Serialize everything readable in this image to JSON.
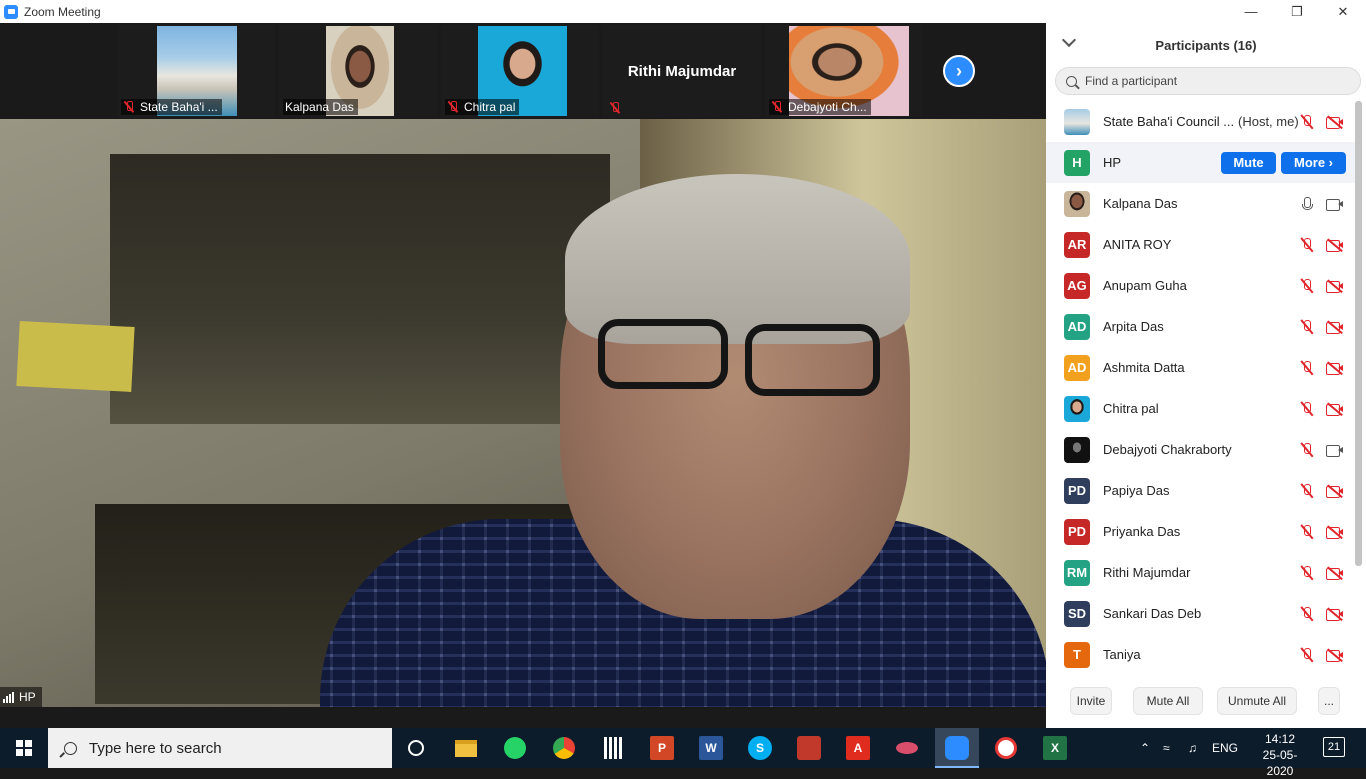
{
  "window": {
    "title": "Zoom Meeting",
    "controls": [
      "minimize",
      "restore",
      "close"
    ]
  },
  "gallery": {
    "tiles": [
      {
        "name": "State Baha'i ...",
        "muted": true,
        "has_video": true,
        "photo": "lotus-temple"
      },
      {
        "name": "Kalpana Das",
        "muted": false,
        "has_video": true,
        "photo": "woman"
      },
      {
        "name": "Chitra pal",
        "muted": true,
        "has_video": true,
        "photo": "woman"
      },
      {
        "name": "Rithi Majumdar",
        "muted": true,
        "has_video": false
      },
      {
        "name": "Debajyoti Ch...",
        "muted": true,
        "has_video": true,
        "photo": "young-man"
      }
    ],
    "next_icon": "chevron-right-icon"
  },
  "main_video": {
    "speaker_label": "HP",
    "icon": "signal-bars-icon"
  },
  "participants": {
    "title": "Participants (16)",
    "search_placeholder": "Find a participant",
    "list": [
      {
        "initials": "",
        "name": "State Baha'i Council ...",
        "tag": "(Host, me)",
        "avatar_color": "#3a6e8f",
        "mic": "muted",
        "cam": "off"
      },
      {
        "initials": "H",
        "name": "HP",
        "avatar_color": "#23a365",
        "mute_label": "Mute",
        "more_label": "More"
      },
      {
        "initials": "",
        "name": "Kalpana Das",
        "avatar_color": "#8a5a44",
        "mic": "on",
        "cam": "on"
      },
      {
        "initials": "AR",
        "name": "ANITA ROY",
        "avatar_color": "#c62828",
        "mic": "muted",
        "cam": "off"
      },
      {
        "initials": "AG",
        "name": "Anupam Guha",
        "avatar_color": "#c62828",
        "mic": "muted",
        "cam": "off"
      },
      {
        "initials": "AD",
        "name": "Arpita Das",
        "avatar_color": "#23a383",
        "mic": "muted",
        "cam": "off"
      },
      {
        "initials": "AD",
        "name": "Ashmita Datta",
        "avatar_color": "#f2a11e",
        "mic": "muted",
        "cam": "off"
      },
      {
        "initials": "",
        "name": "Chitra pal",
        "avatar_color": "#3aa6d8",
        "mic": "muted",
        "cam": "off"
      },
      {
        "initials": "",
        "name": "Debajyoti Chakraborty",
        "avatar_color": "#222222",
        "mic": "muted",
        "cam": "on"
      },
      {
        "initials": "PD",
        "name": "Papiya Das",
        "avatar_color": "#2f3e5c",
        "mic": "muted",
        "cam": "off"
      },
      {
        "initials": "PD",
        "name": "Priyanka Das",
        "avatar_color": "#c62828",
        "mic": "muted",
        "cam": "off"
      },
      {
        "initials": "RM",
        "name": "Rithi Majumdar",
        "avatar_color": "#23a383",
        "mic": "muted",
        "cam": "off"
      },
      {
        "initials": "SD",
        "name": "Sankari Das Deb",
        "avatar_color": "#2f3e5c",
        "mic": "muted",
        "cam": "off"
      },
      {
        "initials": "T",
        "name": "Taniya",
        "avatar_color": "#e5680e",
        "mic": "muted",
        "cam": "off"
      }
    ],
    "footer": {
      "invite": "Invite",
      "mute_all": "Mute All",
      "unmute_all": "Unmute All",
      "more": "..."
    }
  },
  "taskbar": {
    "search_placeholder": "Type here to search",
    "apps": [
      "task-view",
      "file-explorer",
      "whatsapp",
      "chrome",
      "calculator",
      "powerpoint",
      "word",
      "skype",
      "media-app",
      "acrobat",
      "snipping-tool",
      "zoom",
      "app-a",
      "excel"
    ],
    "language": "ENG",
    "time": "14:12",
    "date": "25-05-2020",
    "notifications": "21"
  }
}
